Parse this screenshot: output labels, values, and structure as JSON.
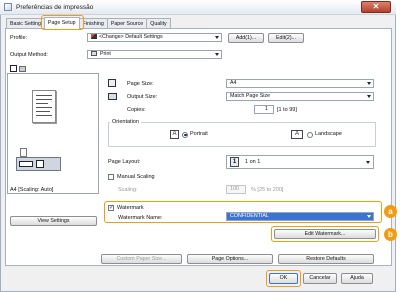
{
  "window": {
    "title": "Preferências de impressão",
    "close_glyph": "✕"
  },
  "tabs": [
    {
      "label": "Basic Setting"
    },
    {
      "label": "Page Setup"
    },
    {
      "label": "Finishing"
    },
    {
      "label": "Paper Source"
    },
    {
      "label": "Quality"
    }
  ],
  "profile": {
    "label": "Profile:",
    "value": "<Change> Default Settings",
    "add_button": "Add(1)...",
    "edit_button": "Edit(2)..."
  },
  "output_method": {
    "label": "Output Method:",
    "value": "Print"
  },
  "preview": {
    "caption": "A4 [Scaling: Auto]"
  },
  "page_size": {
    "label": "Page Size:",
    "value": "A4"
  },
  "output_size": {
    "label": "Output Size:",
    "value": "Match Page Size"
  },
  "copies": {
    "label": "Copies:",
    "value": "1",
    "range": "[1 to 99]"
  },
  "orientation": {
    "label": "Orientation",
    "portrait": "Portrait",
    "landscape": "Landscape",
    "selected": "Portrait"
  },
  "page_layout": {
    "label": "Page Layout:",
    "value": "1 on 1",
    "icon_number": "1"
  },
  "manual_scaling": {
    "label": "Manual Scaling",
    "checked": false,
    "scaling_label": "Scaling:",
    "scaling_value": "100",
    "scaling_range": "% [25 to 200]"
  },
  "watermark": {
    "label": "Watermark",
    "checked": true,
    "name_label": "Watermark Name:",
    "name_value": "CONFIDENTIAL",
    "edit_button": "Edit Watermark..."
  },
  "view_settings_button": "View Settings",
  "custom_paper_button": "Custom Paper Size...",
  "page_options_button": "Page Options...",
  "restore_defaults_button": "Restore Defaults",
  "footer": {
    "ok": "OK",
    "cancel": "Cancelar",
    "help": "Ajuda"
  },
  "callouts": {
    "a": "a",
    "b": "b"
  },
  "colors": {
    "callout": "#f39c12",
    "selection": "#3b74d4"
  }
}
